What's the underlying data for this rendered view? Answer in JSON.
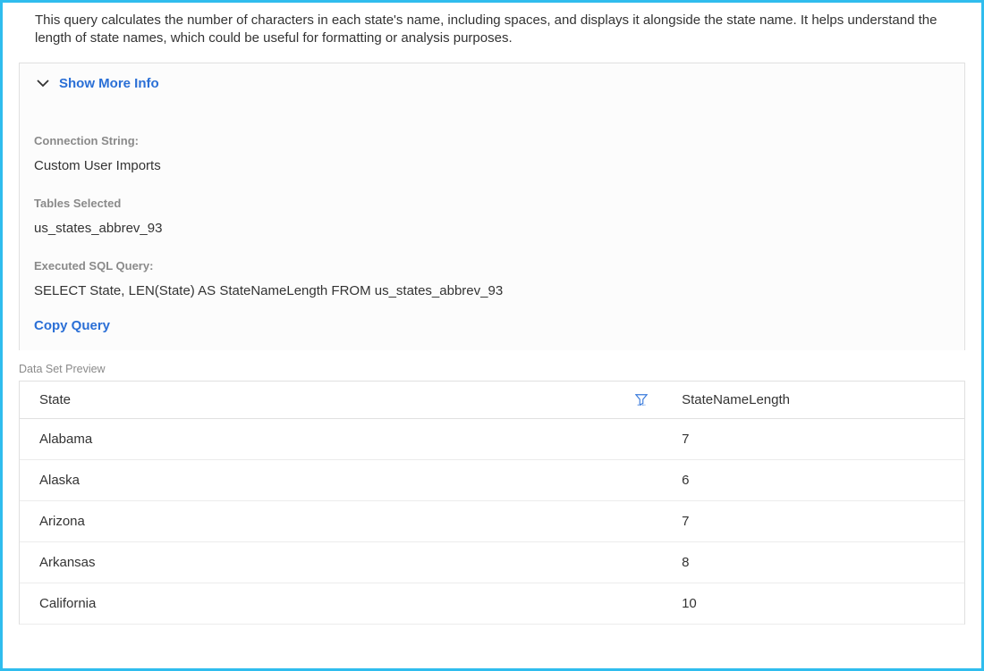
{
  "description": "This query calculates the number of characters in each state's name, including spaces, and displays it alongside the state name. It helps understand the length of state names, which could be useful for formatting or analysis purposes.",
  "info_panel": {
    "show_more_label": "Show More Info",
    "connection_string_label": "Connection String:",
    "connection_string_value": "Custom User Imports",
    "tables_selected_label": "Tables Selected",
    "tables_selected_value": "us_states_abbrev_93",
    "executed_sql_label": "Executed SQL Query:",
    "executed_sql_value": "SELECT State, LEN(State) AS StateNameLength FROM us_states_abbrev_93",
    "copy_query_label": "Copy Query"
  },
  "preview": {
    "label": "Data Set Preview",
    "columns": {
      "state": "State",
      "length": "StateNameLength"
    },
    "rows": [
      {
        "state": "Alabama",
        "length": "7"
      },
      {
        "state": "Alaska",
        "length": "6"
      },
      {
        "state": "Arizona",
        "length": "7"
      },
      {
        "state": "Arkansas",
        "length": "8"
      },
      {
        "state": "California",
        "length": "10"
      }
    ]
  }
}
